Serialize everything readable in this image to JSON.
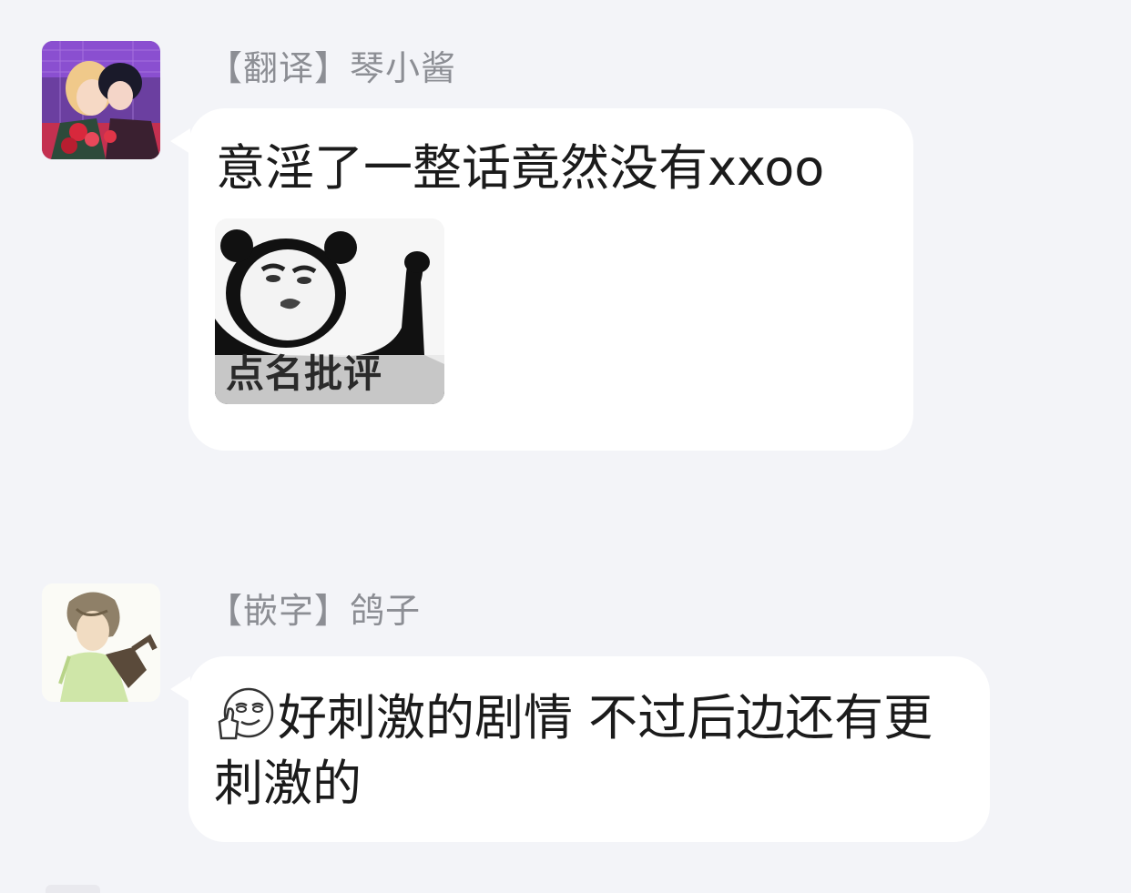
{
  "messages": [
    {
      "sender": "【翻译】琴小酱",
      "text": "意淫了一整话竟然没有xxoo",
      "sticker": {
        "caption": "点名批评"
      }
    },
    {
      "sender": "【嵌字】鸽子",
      "emoji": "smug-thumbs-up-emoji",
      "text": "好刺激的剧情 不过后边还有更刺激的"
    }
  ],
  "colors": {
    "background": "#f3f4f8",
    "bubble": "#ffffff",
    "sender_text": "#8c8e94",
    "message_text": "#1b1b1b"
  }
}
